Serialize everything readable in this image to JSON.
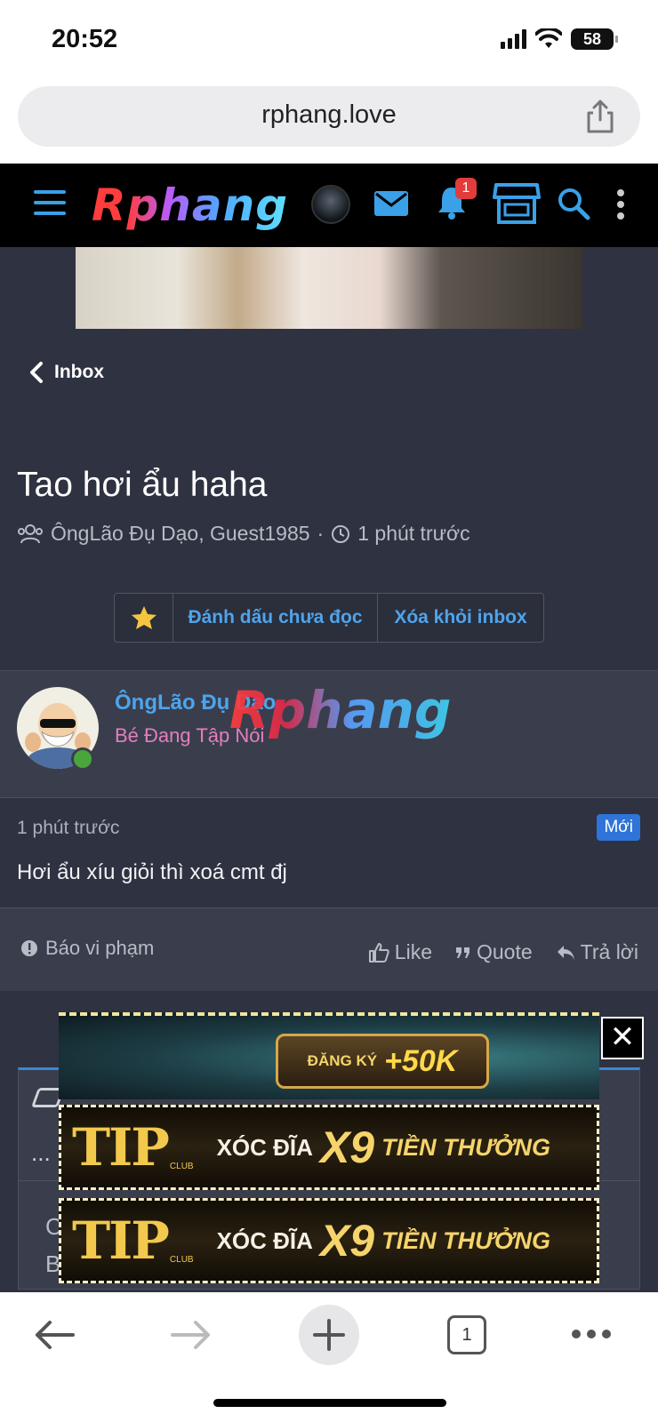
{
  "status_bar": {
    "time": "20:52",
    "battery": "58"
  },
  "browser": {
    "url": "rphang.love",
    "tab_count": "1"
  },
  "site": {
    "logo": "Rphang",
    "notification_count": "1"
  },
  "nav": {
    "back_label": "Inbox"
  },
  "thread": {
    "title": "Tao hơi ẩu haha",
    "participants": "ÔngLão Đụ Dạo, Guest1985",
    "separator": "·",
    "time": "1 phút trước"
  },
  "actions": {
    "mark_unread": "Đánh dấu chưa đọc",
    "remove_inbox": "Xóa khỏi inbox"
  },
  "message": {
    "author": "ÔngLão Đụ Dạo",
    "author_title": "Bé Đang Tập Nói",
    "watermark": "Rphang",
    "time": "1 phút trước",
    "badge": "Mới",
    "text": "Hơi ẩu xíu giỏi thì xoá cmt đj",
    "report": "Báo vi phạm",
    "like": "Like",
    "quote": "Quote",
    "reply": "Trả lời"
  },
  "editor": {
    "more": "...",
    "placeholder_line1": "C",
    "placeholder_line2": "B"
  },
  "ads": {
    "register_label": "ĐĂNG KÝ",
    "register_bonus": "+50K",
    "close": "✕",
    "tip_brand": "TIP",
    "tip_club": "CLUB",
    "tip_game": "XÓC ĐĨA",
    "tip_multiplier": "X9",
    "tip_reward": "TIỀN THƯỞNG"
  },
  "colors": {
    "accent": "#4ea4ec",
    "header_bg": "#000000",
    "page_bg": "#2f3240",
    "badge_red": "#e23b3b",
    "new_badge": "#2f74d8",
    "author_title": "#e57ec0"
  }
}
